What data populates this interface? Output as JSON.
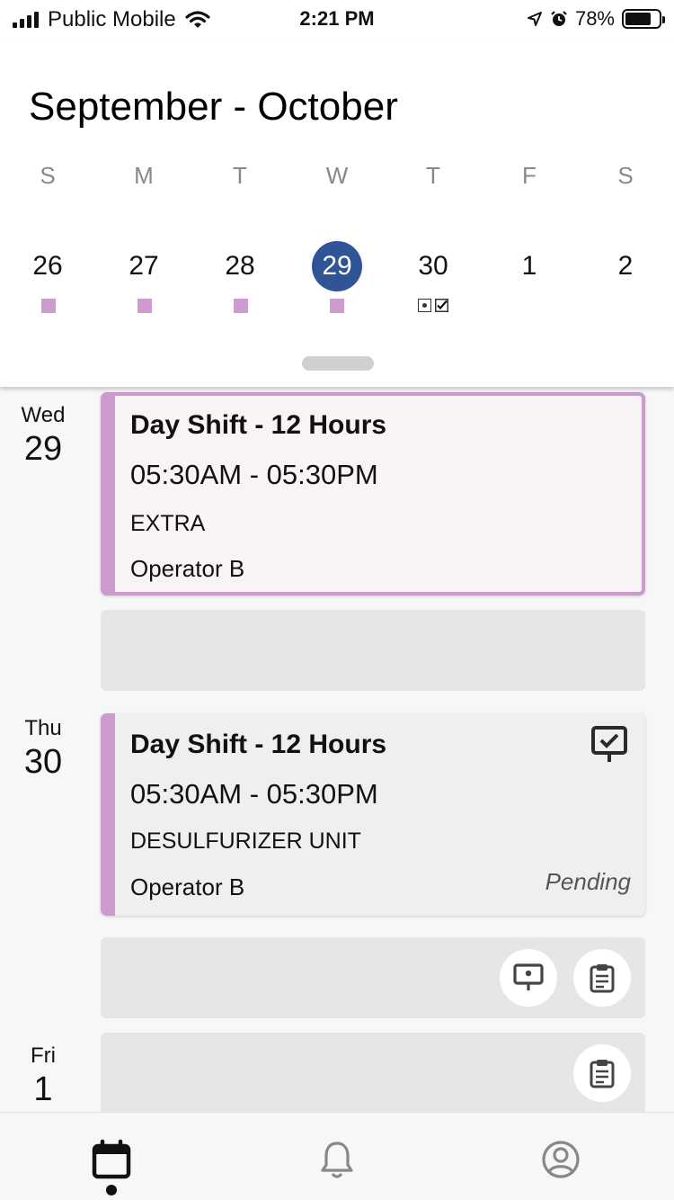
{
  "status_bar": {
    "carrier": "Public Mobile",
    "time": "2:21 PM",
    "battery": "78%",
    "battery_level": 0.78
  },
  "calendar": {
    "title": "September - October",
    "weekdays": [
      "S",
      "M",
      "T",
      "W",
      "T",
      "F",
      "S"
    ],
    "dates": [
      "26",
      "27",
      "28",
      "29",
      "30",
      "1",
      "2"
    ],
    "selected_date": "29",
    "accent_color": "#2f5597",
    "marker_color": "#cc9acd"
  },
  "agenda": {
    "days": [
      {
        "dow": "Wed",
        "num": "29"
      },
      {
        "dow": "Thu",
        "num": "30"
      },
      {
        "dow": "Fri",
        "num": "1"
      }
    ],
    "shifts": [
      {
        "title": "Day Shift - 12 Hours",
        "time": "05:30AM - 05:30PM",
        "location": "EXTRA",
        "role": "Operator B",
        "status": ""
      },
      {
        "title": "Day Shift - 12 Hours",
        "time": "05:30AM - 05:30PM",
        "location": "DESULFURIZER UNIT",
        "role": "Operator B",
        "status": "Pending"
      }
    ]
  },
  "icons": {
    "card_status": "presentation-check-icon",
    "board": "presentation-board-icon",
    "clipboard": "clipboard-icon",
    "nav_calendar": "calendar-icon",
    "nav_notifications": "bell-icon",
    "nav_profile": "profile-icon"
  }
}
